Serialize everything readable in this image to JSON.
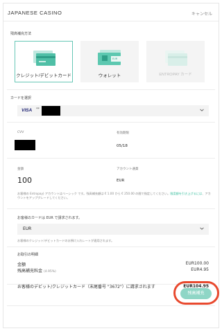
{
  "header": {
    "brand": "JAPANESE CASINO",
    "cancel": "キャンセル"
  },
  "deposit_method": {
    "label": "残高補充方法",
    "options": [
      {
        "label": "クレジット/デビットカード",
        "selected": true,
        "icon": "credit-card-icon"
      },
      {
        "label": "ウォレット",
        "selected": false,
        "icon": "wallet-icon"
      },
      {
        "label": "ENTROPAY カード",
        "selected": false,
        "disabled": true,
        "icon": "entropay-card-icon"
      }
    ],
    "wallet_icon_text": "EUR"
  },
  "card_select": {
    "label": "カードを選択",
    "brand": "VISA",
    "masked": "**"
  },
  "card_details": {
    "cvv_label": "CVV",
    "expiry_label": "有効期限",
    "expiry_value": "05/18"
  },
  "amount": {
    "amount_label": "金額",
    "amount_value": "100",
    "account_currency_label": "アカウント通貨",
    "account_currency_value": "EUR",
    "note": "お客様の Entropay) アカウントはベーシック です。残高補充額は € 1.00 から € 250.00 の間で指定してください。",
    "note_link": "限度額を引き上げるには",
    "note_tail": "、アカウントをアップグレードしてください。"
  },
  "charge_currency": {
    "label": "お客様のカードは EUR で請求されます。",
    "value": "EUR",
    "note": "お客様のクレジット/デビットカードのお預け入れレートが適用されます。"
  },
  "summary": {
    "label": "お取引の明細",
    "rows": [
      {
        "label": "金額",
        "value": "EUR100.00"
      },
      {
        "label": "残高補充料金",
        "fee_rate": "(4.95%)",
        "value": "EUR4.95"
      }
    ],
    "charge_text": "お客様のデビット/クレジットカード（末尾番号 \"3672\"）に請求されます",
    "charge_total": "EUR104.95"
  },
  "pay_button": "残高補充",
  "colors": {
    "accent": "#66c7b5",
    "button": "#8fd6c6",
    "highlight_ring": "#e8492e",
    "link": "#3bbf9f"
  }
}
